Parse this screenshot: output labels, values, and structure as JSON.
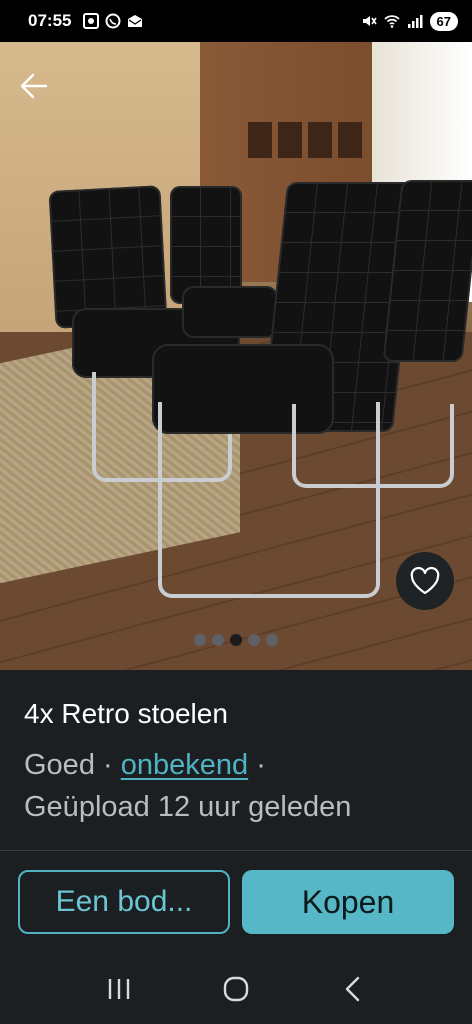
{
  "status": {
    "time": "07:55",
    "battery": "67",
    "icons": [
      "screenshot-icon",
      "whatsapp-icon",
      "mail-icon",
      "mute-icon",
      "wifi-icon",
      "signal-icon"
    ]
  },
  "gallery": {
    "page_count": 5,
    "active_index": 2
  },
  "listing": {
    "title": "4x Retro stoelen",
    "condition": "Goed",
    "separator": " · ",
    "brand_link": "onbekend",
    "separator_end": " ·",
    "uploaded": "Geüpload 12 uur geleden"
  },
  "actions": {
    "offer_label": "Een bod...",
    "buy_label": "Kopen"
  },
  "colors": {
    "accent": "#56b8c6",
    "background": "#1b1f22"
  }
}
